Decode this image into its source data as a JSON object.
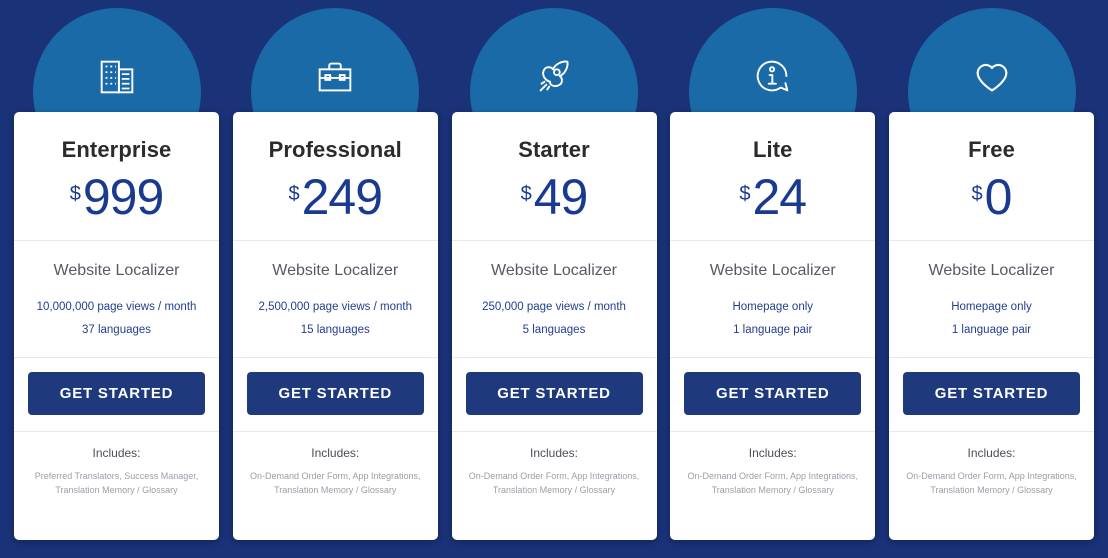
{
  "theme": {
    "background": "#1a3278",
    "arch": "#1a6aa8",
    "card": "#ffffff",
    "price_color": "#1a3a8f",
    "button": "#1e3a7d",
    "spec_color": "#23408e"
  },
  "common": {
    "currency": "$",
    "product": "Website Localizer",
    "cta_label": "GET STARTED",
    "includes_label": "Includes:"
  },
  "plans": [
    {
      "icon": "office-building-icon",
      "name": "Enterprise",
      "currency": "$",
      "amount": "999",
      "product": "Website Localizer",
      "spec_1": "10,000,000 page views / month",
      "spec_2": "37 languages",
      "cta_label": "GET STARTED",
      "includes_label": "Includes:",
      "includes_text": "Preferred Translators, Success Manager, Translation Memory / Glossary"
    },
    {
      "icon": "briefcase-icon",
      "name": "Professional",
      "currency": "$",
      "amount": "249",
      "product": "Website Localizer",
      "spec_1": "2,500,000 page views / month",
      "spec_2": "15 languages",
      "cta_label": "GET STARTED",
      "includes_label": "Includes:",
      "includes_text": "On-Demand Order Form, App Integrations, Translation Memory / Glossary"
    },
    {
      "icon": "rocket-icon",
      "name": "Starter",
      "currency": "$",
      "amount": "49",
      "product": "Website Localizer",
      "spec_1": "250,000 page views / month",
      "spec_2": "5 languages",
      "cta_label": "GET STARTED",
      "includes_label": "Includes:",
      "includes_text": "On-Demand Order Form, App Integrations, Translation Memory / Glossary"
    },
    {
      "icon": "info-bubble-icon",
      "name": "Lite",
      "currency": "$",
      "amount": "24",
      "product": "Website Localizer",
      "spec_1": "Homepage only",
      "spec_2": "1 language pair",
      "cta_label": "GET STARTED",
      "includes_label": "Includes:",
      "includes_text": "On-Demand Order Form, App Integrations, Translation Memory / Glossary"
    },
    {
      "icon": "heart-icon",
      "name": "Free",
      "currency": "$",
      "amount": "0",
      "product": "Website Localizer",
      "spec_1": "Homepage only",
      "spec_2": "1 language pair",
      "cta_label": "GET STARTED",
      "includes_label": "Includes:",
      "includes_text": "On-Demand Order Form, App Integrations, Translation Memory / Glossary"
    }
  ]
}
